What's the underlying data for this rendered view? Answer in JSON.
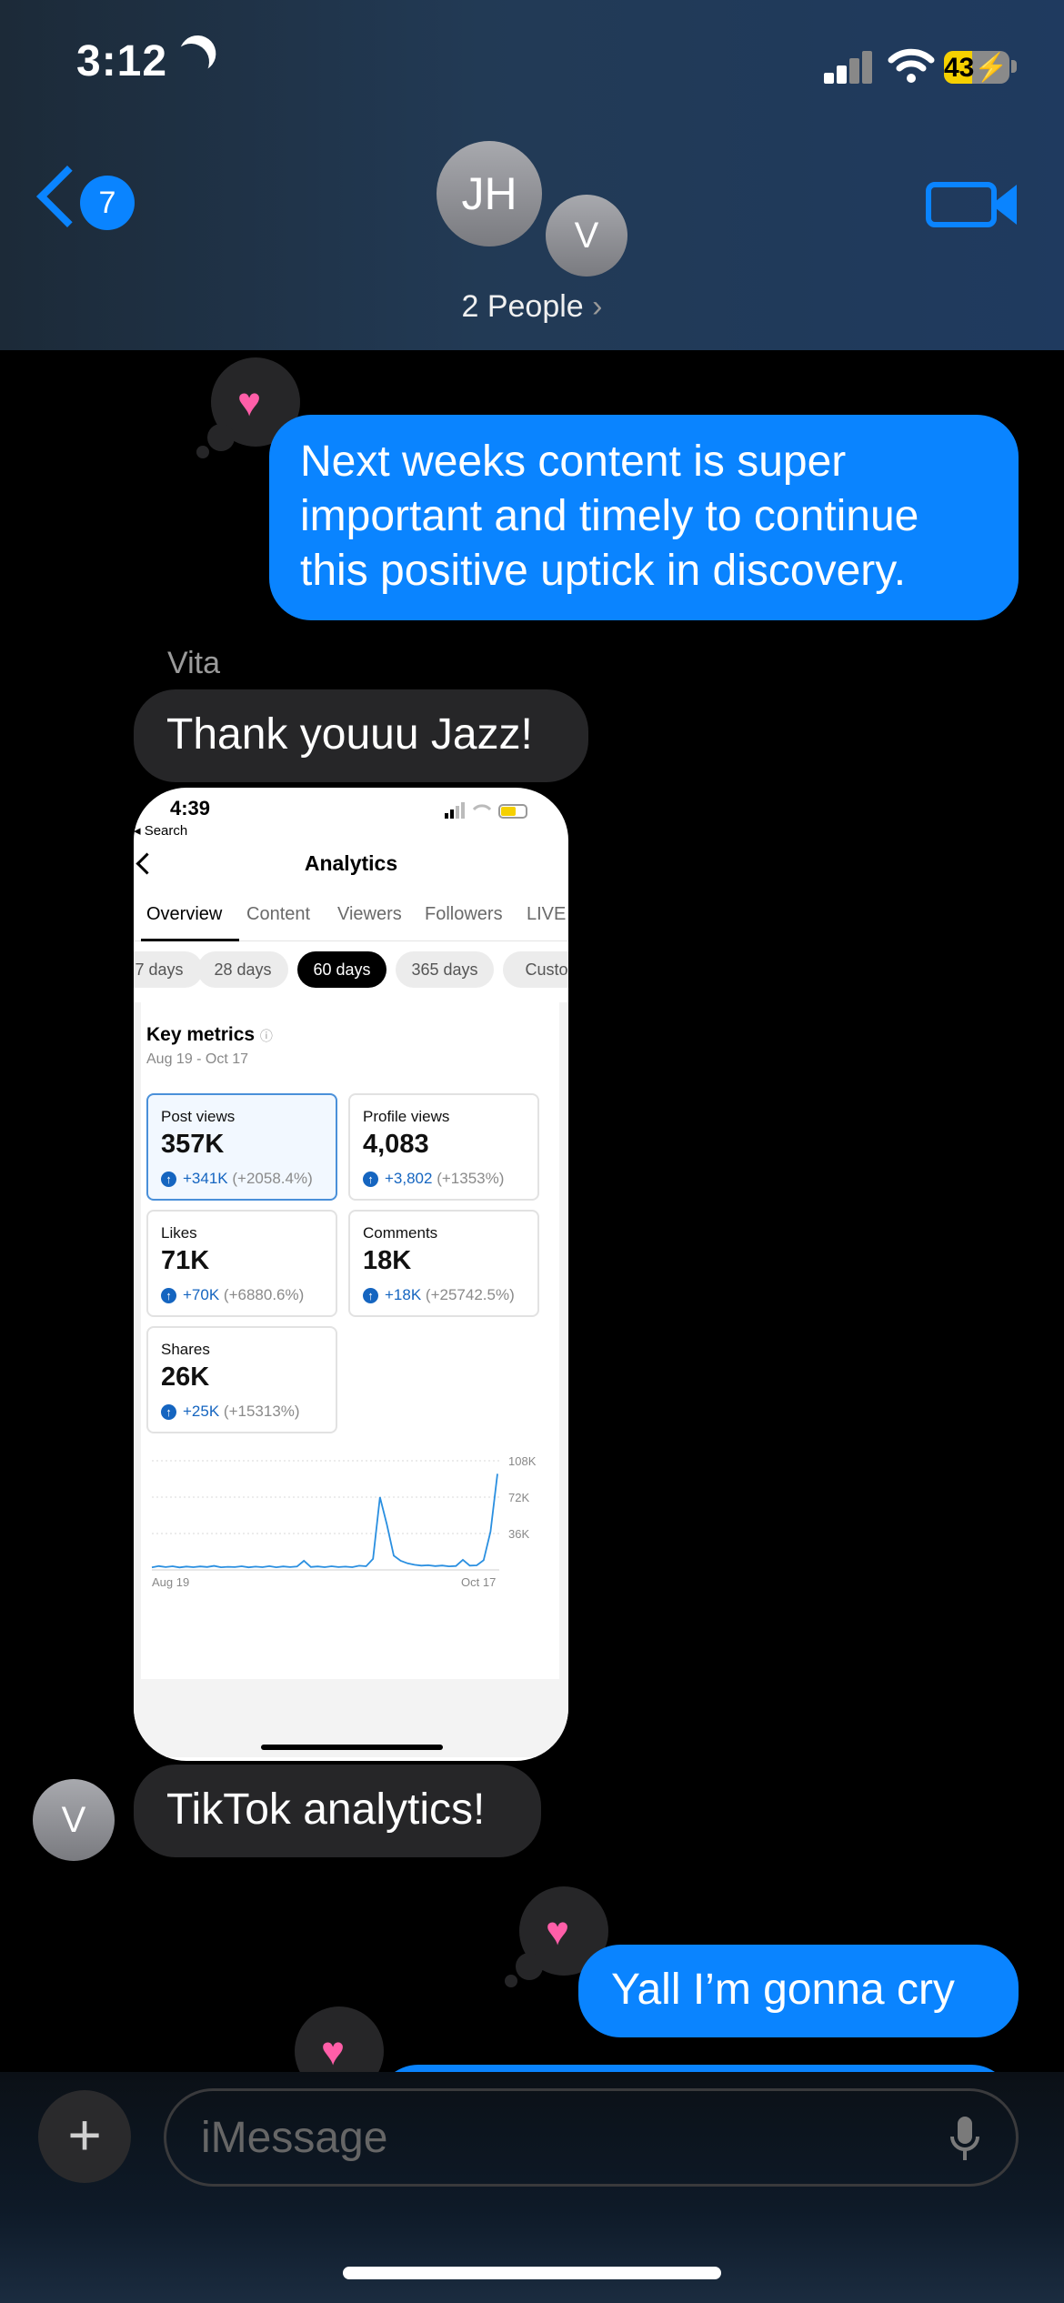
{
  "status_bar": {
    "time": "3:12",
    "battery": "43"
  },
  "header": {
    "back_count": "7",
    "avatars": [
      "JH",
      "V"
    ],
    "title": "2 People",
    "chevron": "›"
  },
  "messages": {
    "m1": {
      "lines": [
        "Next weeks content is super",
        "important and timely to continue",
        "this positive uptick in discovery."
      ]
    },
    "sender": "Vita",
    "m2": "Thank youuu Jazz!",
    "m3": "TikTok analytics!",
    "m3_avatar": "V",
    "m4": "Yall I’m gonna cry"
  },
  "screenshot": {
    "time": "4:39",
    "back_label": "◂ Search",
    "title": "Analytics",
    "tabs": [
      "Overview",
      "Content",
      "Viewers",
      "Followers",
      "LIVE"
    ],
    "ranges": [
      "7 days",
      "28 days",
      "60 days",
      "365 days",
      "Custo"
    ],
    "key_metrics_title": "Key metrics",
    "date_range": "Aug 19 - Oct 17",
    "metrics": [
      {
        "label": "Post views",
        "value": "357K",
        "change": "+341K",
        "pct": "(+2058.4%)"
      },
      {
        "label": "Profile views",
        "value": "4,083",
        "change": "+3,802",
        "pct": "(+1353%)"
      },
      {
        "label": "Likes",
        "value": "71K",
        "change": "+70K",
        "pct": "(+6880.6%)"
      },
      {
        "label": "Comments",
        "value": "18K",
        "change": "+18K",
        "pct": "(+25742.5%)"
      },
      {
        "label": "Shares",
        "value": "26K",
        "change": "+25K",
        "pct": "(+15313%)"
      }
    ],
    "chart_data": {
      "type": "line",
      "ytick_labels": [
        "108K",
        "72K",
        "36K"
      ],
      "xtick_labels": [
        "Aug 19",
        "Oct 17"
      ],
      "ylim": [
        0,
        108000
      ],
      "series": [
        {
          "values": [
            2500,
            3800,
            2800,
            3600,
            2400,
            3300,
            2700,
            3400,
            2900,
            4000,
            2600,
            3100,
            2800,
            3600,
            2500,
            3200,
            2700,
            3700,
            2600,
            3400,
            2800,
            3300,
            9000,
            2900,
            3400,
            2700,
            3600,
            2800,
            3200,
            2700,
            4100,
            3600,
            11000,
            72000,
            45000,
            14000,
            9000,
            6500,
            5000,
            4200,
            4600,
            3800,
            4300,
            3500,
            3900,
            10000,
            4200,
            4500,
            9500,
            38000,
            95000
          ]
        }
      ],
      "color": "#2a8fe0"
    }
  },
  "compose": {
    "placeholder": "iMessage",
    "plus": "+"
  }
}
